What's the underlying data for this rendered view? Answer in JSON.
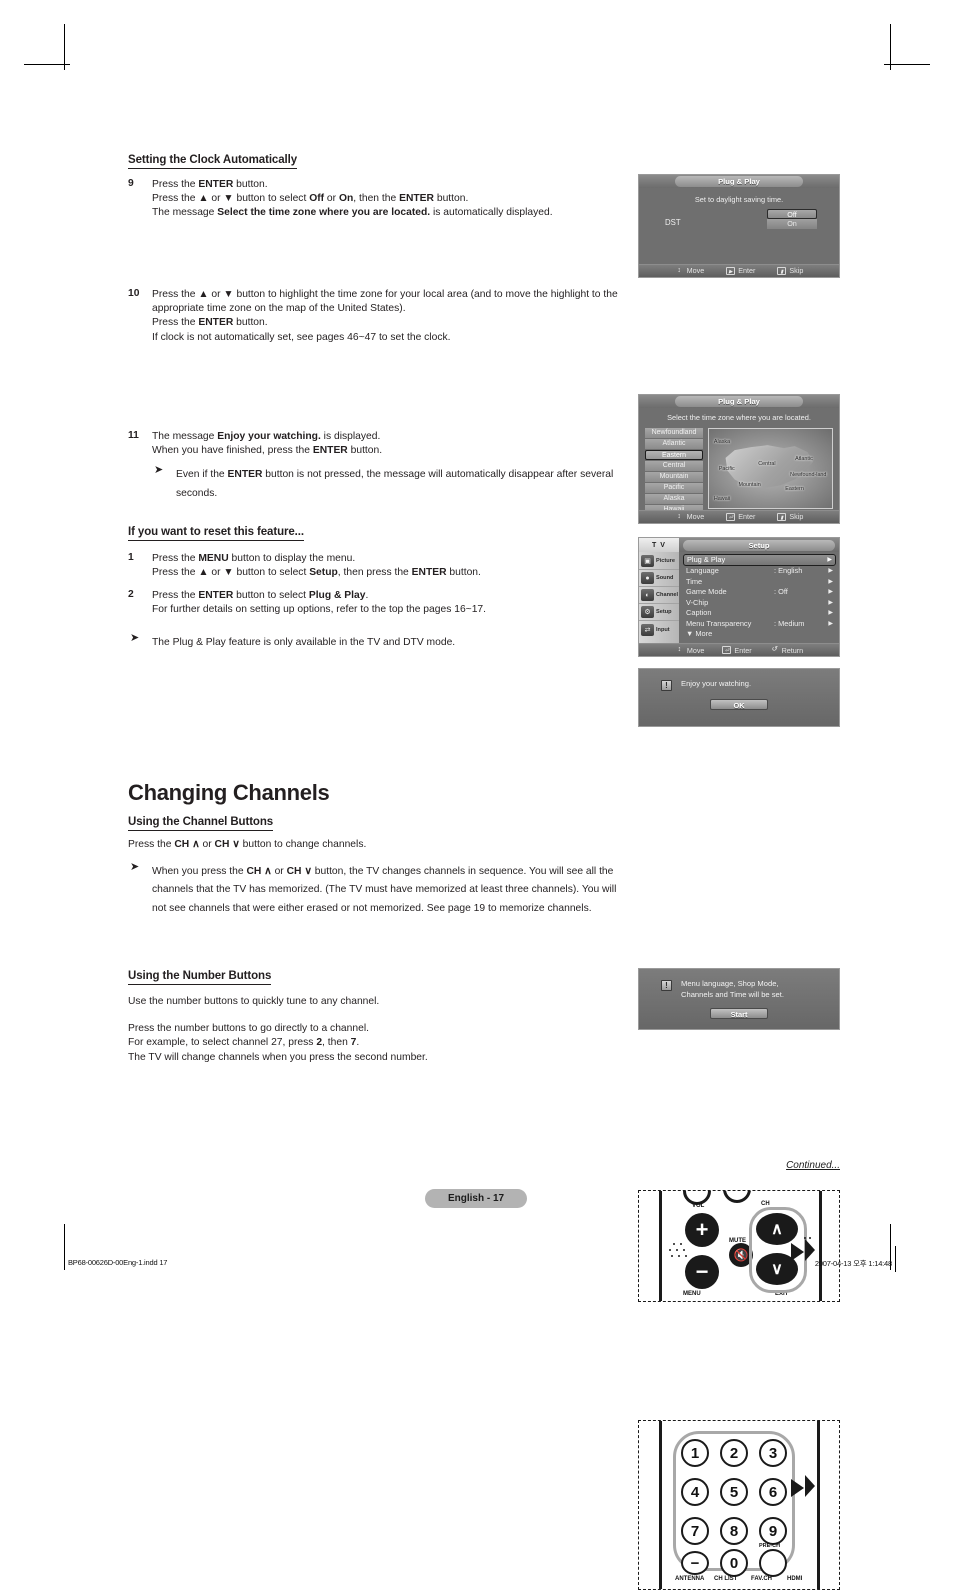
{
  "doc": {
    "page_label": "English - 17",
    "continued": "Continued...",
    "footer_left": "BP68-00626D-00Eng-1.indd    17",
    "footer_right": "2007-04-13   오후 1:14:48"
  },
  "sections": {
    "clock_heading": "Setting the Clock Automatically",
    "reset_heading": "If you want to reset this feature...",
    "changing_channels_title": "Changing Channels",
    "channel_buttons_heading": "Using the Channel Buttons",
    "number_buttons_heading": "Using the Number Buttons"
  },
  "steps": [
    {
      "num": "9",
      "lines": [
        "Press the <b>ENTER</b> button.",
        "Press the ▲ or ▼ button to select <b>Off</b> or <b>On</b>, then the <b>ENTER</b> button.",
        "The message <b>Select the time zone where you are located.</b> is automatically displayed."
      ]
    },
    {
      "num": "10",
      "lines": [
        "Press the ▲ or ▼ button to highlight the time zone for your local area (and to move the highlight to the appropriate time zone on the map of the United States).",
        "Press the <b>ENTER</b> button.",
        "If clock is not automatically set, see pages 46~47 to set the clock."
      ]
    },
    {
      "num": "11",
      "lines": [
        "The message <b>Enjoy your watching.</b> is displayed.",
        "When you have finished, press the <b>ENTER</b> button."
      ],
      "note": "Even if the <b>ENTER</b> button is not pressed, the message will automatically disappear after several seconds."
    }
  ],
  "reset_steps": [
    {
      "num": "1",
      "lines": [
        "Press the <b>MENU</b> button to display the menu.",
        "Press the ▲ or ▼ button to select <b>Setup</b>, then press the <b>ENTER</b> button."
      ]
    },
    {
      "num": "2",
      "lines": [
        "Press the <b>ENTER</b> button to select <b>Plug &amp; Play</b>.",
        "For further details on setting up options, refer to the top the pages 16~17."
      ]
    }
  ],
  "reset_note": "The Plug &amp; Play feature is only available in the TV and DTV mode.",
  "channel_buttons": {
    "intro": "Press the <b>CH ∧</b> or <b>CH ∨</b> button to change channels.",
    "note": "When you press the <b>CH ∧</b> or <b>CH ∨</b> button, the TV changes channels in sequence. You will see all the channels that the TV has memorized. (The TV must have memorized at least three channels). You will not see channels that were either erased or not memorized. See page 19 to memorize channels."
  },
  "number_buttons": {
    "intro": "Use the number buttons to quickly tune to any channel.",
    "lines": [
      "Press the number buttons to go directly to a channel.",
      "For example, to select channel 27, press <b>2</b>, then <b>7</b>.",
      "The TV will change channels when you press the second number."
    ]
  },
  "osd": {
    "dst_screen": {
      "title": "Plug & Play",
      "subtitle": "Set to daylight saving time.",
      "label": "DST",
      "options": [
        "Off",
        "On"
      ],
      "selected": "Off",
      "hints": [
        {
          "icon": "updown-icon",
          "label": "Move"
        },
        {
          "icon": "enter-icon",
          "label": "Enter"
        },
        {
          "icon": "skip-icon",
          "label": "Skip"
        }
      ]
    },
    "timezone_screen": {
      "title": "Plug & Play",
      "subtitle": "Select the time zone where you are located.",
      "zones": [
        "Newfoundland",
        "Atlantic",
        "Eastern",
        "Central",
        "Mountain",
        "Pacific",
        "Alaska",
        "Hawaii"
      ],
      "selected": "Eastern",
      "map_labels": [
        "Alaska",
        "Pacific",
        "Central",
        "Atlantic",
        "Newfound-land",
        "Mountain",
        "Eastern",
        "Hawaii"
      ],
      "hints": [
        {
          "icon": "updown-icon",
          "label": "Move"
        },
        {
          "icon": "enter-icon",
          "label": "Enter"
        },
        {
          "icon": "skip-icon",
          "label": "Skip"
        }
      ]
    },
    "enjoy_dialog": {
      "message": "Enjoy your watching.",
      "button": "OK"
    },
    "setup_menu": {
      "source_label": "T V",
      "title": "Setup",
      "side_items": [
        {
          "icon": "picture-icon",
          "label": "Picture"
        },
        {
          "icon": "sound-icon",
          "label": "Sound"
        },
        {
          "icon": "channel-icon",
          "label": "Channel"
        },
        {
          "icon": "setup-icon",
          "label": "Setup"
        },
        {
          "icon": "input-icon",
          "label": "Input"
        }
      ],
      "rows": [
        {
          "name": "Plug & Play",
          "value": "",
          "selected": true
        },
        {
          "name": "Language",
          "value": ": English",
          "selected": false
        },
        {
          "name": "Time",
          "value": "",
          "selected": false
        },
        {
          "name": "Game Mode",
          "value": ": Off",
          "selected": false
        },
        {
          "name": "V-Chip",
          "value": "",
          "selected": false
        },
        {
          "name": "Caption",
          "value": "",
          "selected": false
        },
        {
          "name": "Menu Transparency",
          "value": ": Medium",
          "selected": false
        },
        {
          "name": "▼ More",
          "value": "",
          "selected": false
        }
      ],
      "hints": [
        {
          "icon": "updown-icon",
          "label": "Move"
        },
        {
          "icon": "enter-icon",
          "label": "Enter"
        },
        {
          "icon": "return-icon",
          "label": "Return"
        }
      ]
    },
    "start_dialog": {
      "message_line1": "Menu language, Shop Mode,",
      "message_line2": "Channels and Time will be set.",
      "button": "Start"
    }
  },
  "remote_channel": {
    "labels": {
      "vol": "VOL",
      "ch": "CH",
      "mute": "MUTE",
      "menu": "MENU",
      "exit": "EXIT"
    },
    "buttons": {
      "vol_up": "+",
      "vol_down": "−",
      "ch_up": "∧",
      "ch_down": "∨"
    }
  },
  "remote_numbers": {
    "keys": [
      "1",
      "2",
      "3",
      "4",
      "5",
      "6",
      "7",
      "8",
      "9",
      "−",
      "0"
    ],
    "prech_label": "PRE-CH",
    "bottom_labels": [
      "ANTENNA",
      "CH LIST",
      "FAV.CH",
      "HDMI"
    ]
  }
}
